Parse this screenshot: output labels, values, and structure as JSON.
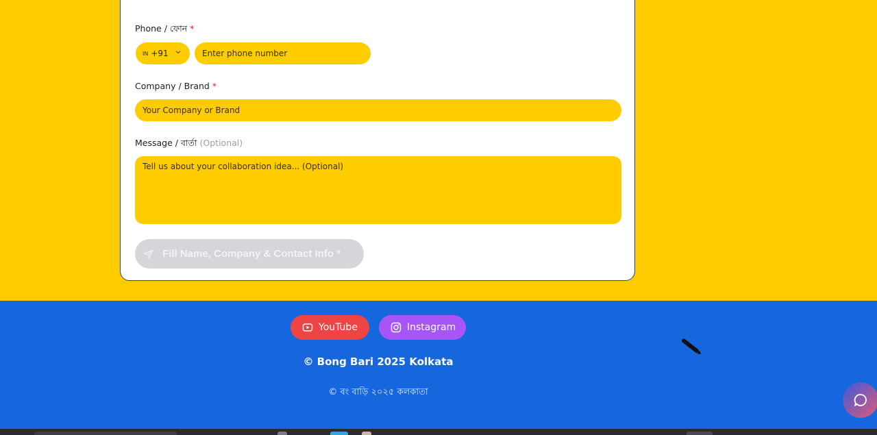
{
  "form": {
    "phone": {
      "label": "Phone / ফোন",
      "required_mark": "*",
      "country_code": "IN",
      "dial_code": "+91",
      "placeholder": "Enter phone number"
    },
    "company": {
      "label": "Company / Brand",
      "required_mark": "*",
      "placeholder": "Your Company or Brand"
    },
    "message": {
      "label": "Message / বার্তা",
      "optional_tag": "(Optional)",
      "placeholder": "Tell us about your collaboration idea... (Optional)"
    },
    "submit": {
      "label": "Fill Name, Company & Contact Info *",
      "icon": "send-icon"
    }
  },
  "footer": {
    "youtube_label": "YouTube",
    "instagram_label": "Instagram",
    "copyright_en": "© Bong Bari 2025 Kolkata",
    "copyright_bn": "© বং বাড়ি ২০২৫ কলকাতা"
  },
  "chat": {
    "icon": "chat-bubble-icon"
  },
  "colors": {
    "page_background": "#ffcc00",
    "input_background": "#ffcc00",
    "footer_background": "#1667de",
    "youtube": "#ef4444",
    "instagram": "#a855f7",
    "required": "#e02424"
  }
}
